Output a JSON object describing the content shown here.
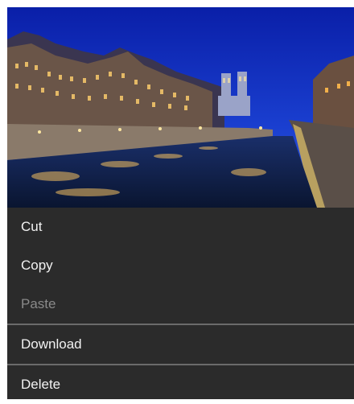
{
  "image": {
    "subject": "night-river-cityscape"
  },
  "context_menu": {
    "items": [
      {
        "label": "Cut",
        "enabled": true
      },
      {
        "label": "Copy",
        "enabled": true
      },
      {
        "label": "Paste",
        "enabled": false
      },
      {
        "label": "Download",
        "enabled": true
      },
      {
        "label": "Delete",
        "enabled": true
      }
    ]
  },
  "colors": {
    "menu_background": "#2b2b2b",
    "menu_text": "#f2f2f2",
    "disabled_text": "#8a8a8a",
    "separator": "#6b6b6b"
  }
}
